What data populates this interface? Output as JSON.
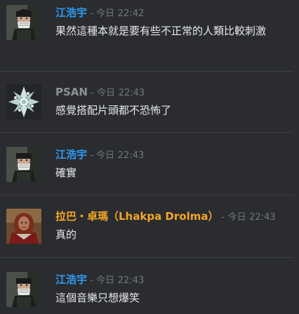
{
  "colors": {
    "background": "#2a2c30",
    "name_blue": "#2f9df5",
    "name_gray": "#8e9297",
    "name_orange": "#f5a623",
    "timestamp": "#72767d",
    "message_text": "#e6e8ea"
  },
  "messages": [
    {
      "author": "江浩宇",
      "separator": " - ",
      "day": "今日",
      "time": "22:42",
      "text": "果然這種本就是要有些不正常的人類比較刺激",
      "avatar_icon": "soldier-avatar-icon"
    },
    {
      "author": "PSAN",
      "separator": " - ",
      "day": "今日",
      "time": "22:43",
      "text": "感覺搭配片頭都不恐怖了",
      "avatar_icon": "crystal-snowflake-avatar-icon"
    },
    {
      "author": "江浩宇",
      "separator": " - ",
      "day": "今日",
      "time": "22:43",
      "text": "確實",
      "avatar_icon": "soldier-avatar-icon"
    },
    {
      "author": "拉巴・卓瑪（Lhakpa Drolma）",
      "separator": " - ",
      "day": "今日",
      "time": "22:43",
      "text": "真的",
      "avatar_icon": "red-hair-woman-avatar-icon"
    },
    {
      "author": "江浩宇",
      "separator": " - ",
      "day": "今日",
      "time": "22:43",
      "text": "這個音樂只想爆笑",
      "avatar_icon": "soldier-avatar-icon"
    }
  ]
}
